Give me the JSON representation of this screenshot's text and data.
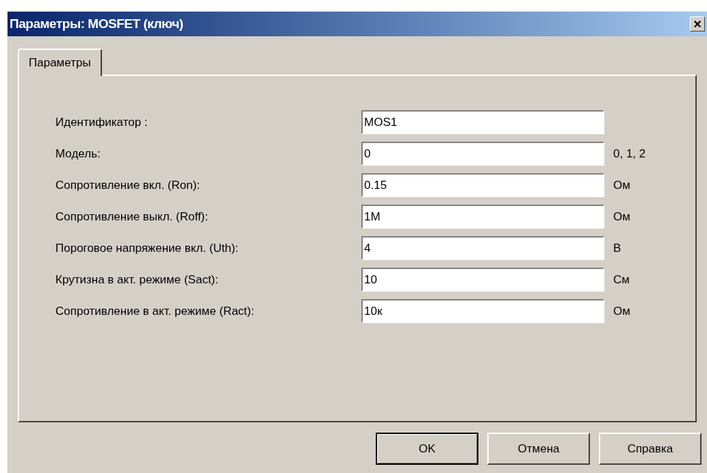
{
  "window": {
    "title": "Параметры: MOSFET (ключ)",
    "close": "×"
  },
  "tabs": [
    {
      "label": "Параметры",
      "selected": true
    }
  ],
  "fields": [
    {
      "label": "Идентификатор :",
      "value": "MOS1"
    },
    {
      "label": "Модель:",
      "value": "0",
      "unit": "0, 1, 2"
    },
    {
      "label": "Сопротивление вкл. (Ron):",
      "value": "0.15",
      "unit": "Ом"
    },
    {
      "label": "Сопротивление выкл. (Roff):",
      "value": "1M",
      "unit": "Ом"
    },
    {
      "label": "Пороговое напряжение вкл. (Uth):",
      "value": "4",
      "unit": "В"
    },
    {
      "label": "Крутизна в акт. режиме (Sact):",
      "value": "10",
      "unit": "См"
    },
    {
      "label": "Сопротивление в акт. режиме (Ract):",
      "value": "10к",
      "unit": "Ом"
    }
  ],
  "buttons": [
    {
      "label": "OK",
      "default": true
    },
    {
      "label": "Отмена",
      "default": false
    },
    {
      "label": "Справка",
      "default": false
    }
  ]
}
